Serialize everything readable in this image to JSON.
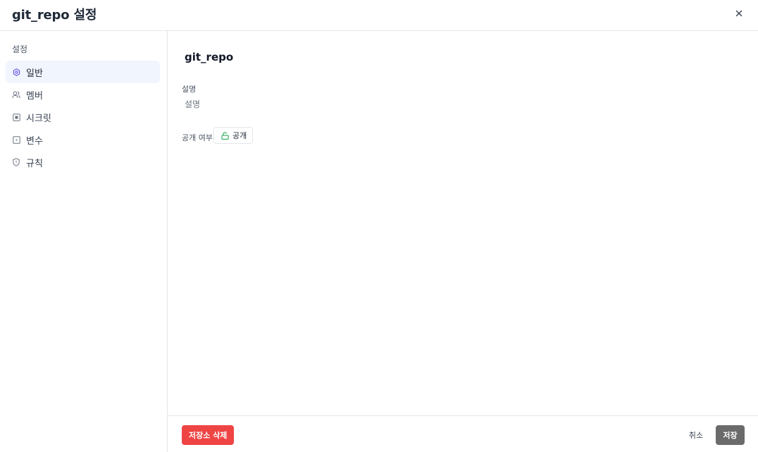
{
  "header": {
    "title": "git_repo 설정",
    "close_icon": "close-icon",
    "close_label": "×"
  },
  "sidebar": {
    "section_label": "설정",
    "items": [
      {
        "label": "일반",
        "icon": "gear-icon",
        "active": true
      },
      {
        "label": "멤버",
        "icon": "users-icon",
        "active": false
      },
      {
        "label": "시크릿",
        "icon": "secret-icon",
        "active": false
      },
      {
        "label": "변수",
        "icon": "variable-icon",
        "active": false
      },
      {
        "label": "규칙",
        "icon": "shield-icon",
        "active": false
      }
    ]
  },
  "main": {
    "repo_name": "git_repo",
    "description": {
      "label": "설명",
      "value": "",
      "placeholder": "설명"
    },
    "visibility": {
      "label": "공개 여부",
      "value": "공개",
      "icon": "unlock-icon"
    }
  },
  "footer": {
    "delete_label": "저장소 삭제",
    "cancel_label": "취소",
    "save_label": "저장"
  },
  "colors": {
    "accent": "#4f46e5",
    "danger": "#ef4444",
    "active_bg": "#f1f5fd",
    "save_bg": "#6b6b6b",
    "public_icon": "#16a34a"
  }
}
